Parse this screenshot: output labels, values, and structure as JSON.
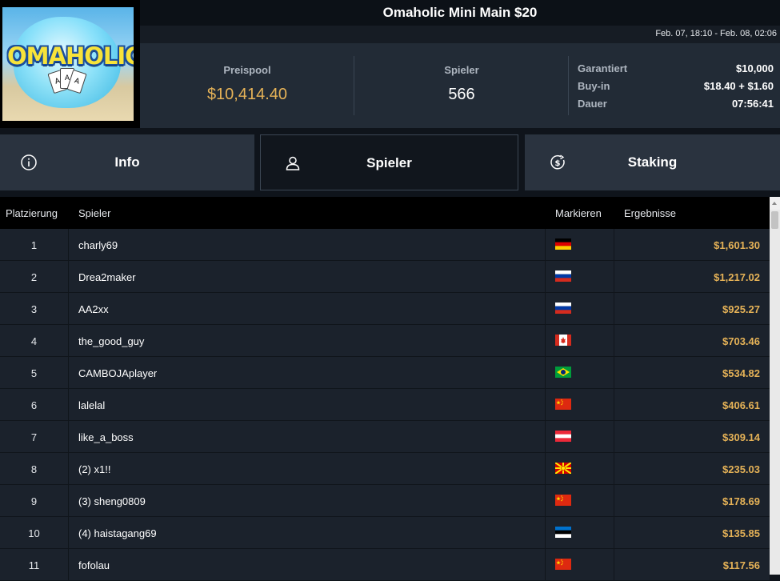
{
  "logo": {
    "text": "OMAHOLIC"
  },
  "header": {
    "title": "Omaholic Mini Main $20",
    "date_range": "Feb. 07, 18:10 - Feb. 08, 02:06"
  },
  "stats": {
    "prizepool_label": "Preispool",
    "prizepool_value": "$10,414.40",
    "players_label": "Spieler",
    "players_value": "566",
    "guaranteed_label": "Garantiert",
    "guaranteed_value": "$10,000",
    "buyin_label": "Buy-in",
    "buyin_value": "$18.40 + $1.60",
    "duration_label": "Dauer",
    "duration_value": "07:56:41"
  },
  "tabs": [
    {
      "label": "Info",
      "icon": "info-icon"
    },
    {
      "label": "Spieler",
      "icon": "user-icon"
    },
    {
      "label": "Staking",
      "icon": "dollar-icon"
    }
  ],
  "table": {
    "columns": [
      "Platzierung",
      "Spieler",
      "Markieren",
      "Ergebnisse"
    ],
    "rows": [
      {
        "rank": "1",
        "player": "charly69",
        "flag": "germany-flag",
        "result": "$1,601.30"
      },
      {
        "rank": "2",
        "player": "Drea2maker",
        "flag": "russia-flag",
        "result": "$1,217.02"
      },
      {
        "rank": "3",
        "player": "AA2xx",
        "flag": "russia-flag",
        "result": "$925.27"
      },
      {
        "rank": "4",
        "player": "the_good_guy",
        "flag": "canada-flag",
        "result": "$703.46"
      },
      {
        "rank": "5",
        "player": "CAMBOJAplayer",
        "flag": "brazil-flag",
        "result": "$534.82"
      },
      {
        "rank": "6",
        "player": "lalelal",
        "flag": "china-flag",
        "result": "$406.61"
      },
      {
        "rank": "7",
        "player": "like_a_boss",
        "flag": "austria-flag",
        "result": "$309.14"
      },
      {
        "rank": "8",
        "player": "(2) x1!!",
        "flag": "north-macedonia-flag",
        "result": "$235.03"
      },
      {
        "rank": "9",
        "player": "(3) sheng0809",
        "flag": "china-flag",
        "result": "$178.69"
      },
      {
        "rank": "10",
        "player": "(4) haistagang69",
        "flag": "estonia-flag",
        "result": "$135.85"
      },
      {
        "rank": "11",
        "player": "fofolau",
        "flag": "china-flag",
        "result": "$117.56"
      }
    ]
  },
  "colors": {
    "accent_gold": "#e5b257",
    "background": "#0f141b",
    "panel": "#222b36"
  }
}
